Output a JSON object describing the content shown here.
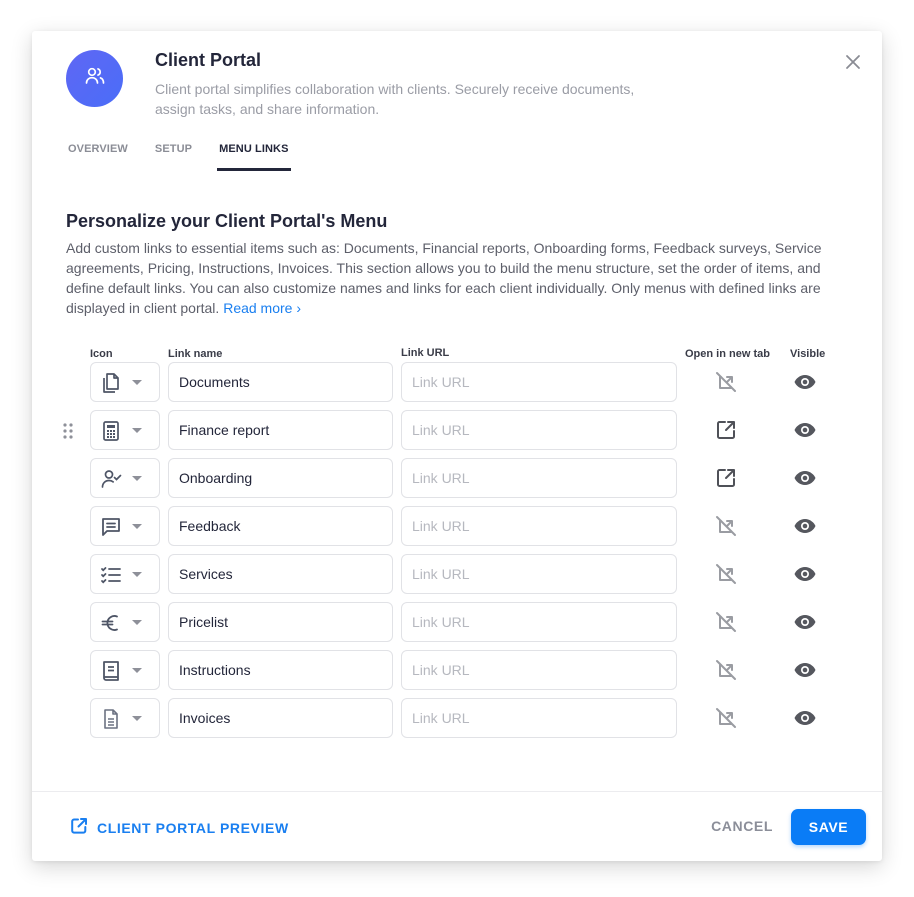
{
  "header": {
    "title": "Client Portal",
    "description": "Client portal simplifies collaboration with clients. Securely receive documents, assign tasks, and share information.",
    "avatar_icon": "users-icon",
    "close_icon": "close-icon"
  },
  "tabs": [
    {
      "label": "OVERVIEW",
      "active": false
    },
    {
      "label": "SETUP",
      "active": false
    },
    {
      "label": "MENU LINKS",
      "active": true
    }
  ],
  "section": {
    "title": "Personalize your Client Portal's Menu",
    "description": "Add custom links to essential items such as: Documents, Financial reports, Onboarding forms, Feedback surveys, Service agreements, Pricing, Instructions, Invoices. This section allows you to build the menu structure, set the order of items, and define default links. You can also customize names and links for each client individually. Only menus with defined links are displayed in client portal.",
    "read_more": "Read more ›"
  },
  "table": {
    "headers": {
      "icon": "Icon",
      "link_name": "Link name",
      "link_url": "Link URL",
      "open_new_tab": "Open in new tab",
      "visible": "Visible"
    },
    "url_placeholder": "Link URL",
    "rows": [
      {
        "icon": "documents-icon",
        "name": "Documents",
        "url": "",
        "open_in_new_tab": false,
        "visible": true
      },
      {
        "icon": "calculator-icon",
        "name": "Finance report",
        "url": "",
        "open_in_new_tab": true,
        "visible": true
      },
      {
        "icon": "user-check-icon",
        "name": "Onboarding",
        "url": "",
        "open_in_new_tab": true,
        "visible": true
      },
      {
        "icon": "message-icon",
        "name": "Feedback",
        "url": "",
        "open_in_new_tab": false,
        "visible": true
      },
      {
        "icon": "checklist-icon",
        "name": "Services",
        "url": "",
        "open_in_new_tab": false,
        "visible": true
      },
      {
        "icon": "euro-icon",
        "name": "Pricelist",
        "url": "",
        "open_in_new_tab": false,
        "visible": true
      },
      {
        "icon": "book-icon",
        "name": "Instructions",
        "url": "",
        "open_in_new_tab": false,
        "visible": true
      },
      {
        "icon": "file-text-icon",
        "name": "Invoices",
        "url": "",
        "open_in_new_tab": false,
        "visible": true
      }
    ]
  },
  "footer": {
    "preview_label": "CLIENT PORTAL PREVIEW",
    "cancel_label": "CANCEL",
    "save_label": "SAVE"
  },
  "colors": {
    "accent": "#0a7cf6",
    "link": "#1a7ff0",
    "title": "#23263a",
    "muted": "#9a9ca5",
    "avatar_gradient_start": "#5f67f4",
    "avatar_gradient_end": "#4a6df8"
  }
}
